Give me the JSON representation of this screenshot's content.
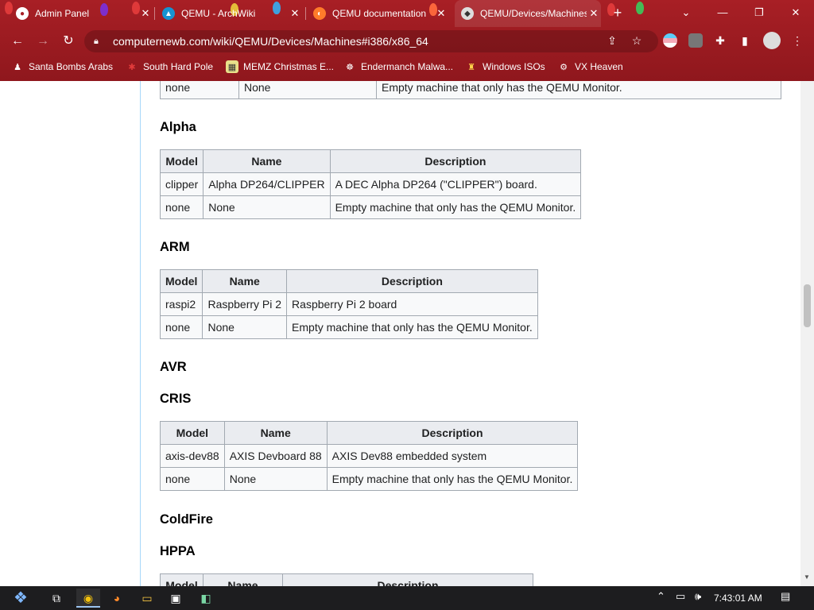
{
  "browser": {
    "tabs": [
      {
        "title": "Admin Panel",
        "active": false
      },
      {
        "title": "QEMU - ArchWiki",
        "active": false
      },
      {
        "title": "QEMU documentation",
        "active": false
      },
      {
        "title": "QEMU/Devices/Machines",
        "active": true
      }
    ],
    "close_glyph": "✕",
    "new_tab_glyph": "+",
    "url": "computernewb.com/wiki/QEMU/Devices/Machines#i386/x86_64",
    "bookmarks": [
      {
        "label": "Santa Bombs Arabs"
      },
      {
        "label": "South Hard Pole"
      },
      {
        "label": "MEMZ Christmas E..."
      },
      {
        "label": "Endermanch Malwa..."
      },
      {
        "label": "Windows ISOs"
      },
      {
        "label": "VX Heaven"
      }
    ],
    "theme_color": "#a81f25"
  },
  "page": {
    "top_table": {
      "rows": [
        [
          "none",
          "None",
          "Empty machine that only has the QEMU Monitor."
        ]
      ]
    },
    "sections": {
      "alpha": {
        "heading": "Alpha",
        "headers": [
          "Model",
          "Name",
          "Description"
        ],
        "rows": [
          [
            "clipper",
            "Alpha DP264/CLIPPER",
            "A DEC Alpha DP264 (\"CLIPPER\") board."
          ],
          [
            "none",
            "None",
            "Empty machine that only has the QEMU Monitor."
          ]
        ]
      },
      "arm": {
        "heading": "ARM",
        "headers": [
          "Model",
          "Name",
          "Description"
        ],
        "rows": [
          [
            "raspi2",
            "Raspberry Pi 2",
            "Raspberry Pi 2 board"
          ],
          [
            "none",
            "None",
            "Empty machine that only has the QEMU Monitor."
          ]
        ]
      },
      "avr": {
        "heading": "AVR"
      },
      "cris": {
        "heading": "CRIS",
        "headers": [
          "Model",
          "Name",
          "Description"
        ],
        "rows": [
          [
            "axis-dev88",
            "AXIS Devboard 88",
            "AXIS Dev88 embedded system"
          ],
          [
            "none",
            "None",
            "Empty machine that only has the QEMU Monitor."
          ]
        ]
      },
      "coldfire": {
        "heading": "ColdFire"
      },
      "hppa": {
        "heading": "HPPA",
        "headers": [
          "Model",
          "Name",
          "Description"
        ]
      }
    }
  },
  "taskbar": {
    "clock": "7:43:01 AM"
  }
}
